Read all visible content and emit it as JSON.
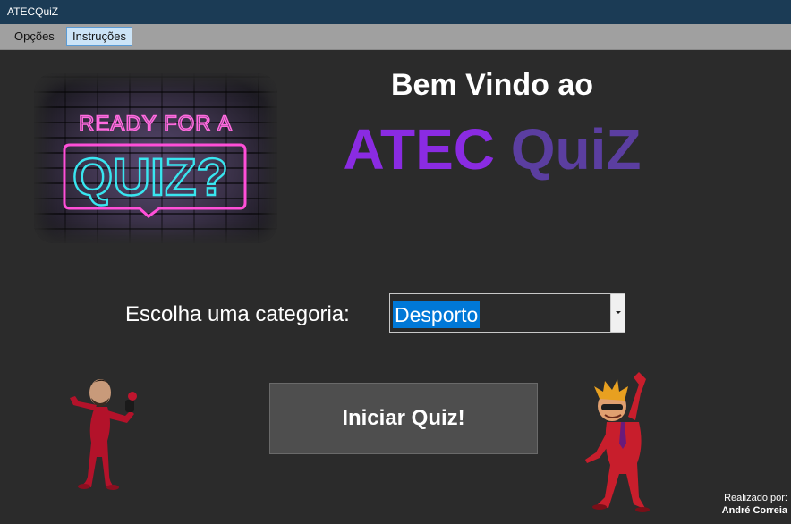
{
  "window": {
    "title": "ATECQuiZ"
  },
  "menu": {
    "items": [
      "Opções",
      "Instruções"
    ]
  },
  "banner": {
    "line1": "READY FOR A",
    "line2": "QUIZ?"
  },
  "welcome": {
    "text": "Bem Vindo ao"
  },
  "brand": {
    "part1": "ATEC",
    "part2": "QuiZ",
    "color1": "#8a2be2",
    "color2": "#5b3ea0"
  },
  "category": {
    "label": "Escolha uma categoria:",
    "selected": "Desporto"
  },
  "start_button": {
    "label": "Iniciar Quiz!"
  },
  "credit": {
    "prefix": "Realizado por:",
    "author": "André Correia"
  },
  "icons": [
    "dropdown-arrow-icon",
    "presenter-character-left",
    "presenter-character-right"
  ]
}
